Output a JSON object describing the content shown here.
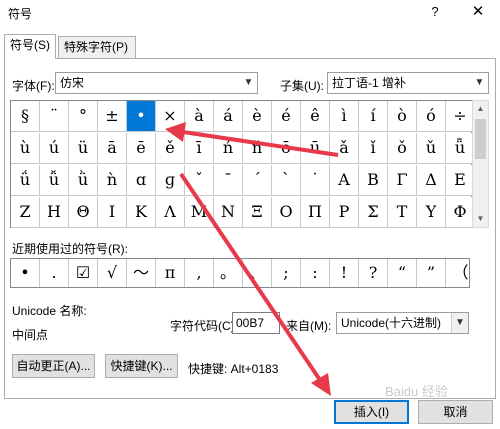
{
  "dialog": {
    "title": "符号",
    "help": "?",
    "close": "✕"
  },
  "tabs": [
    {
      "label": "符号(S)"
    },
    {
      "label": "特殊字符(P)"
    }
  ],
  "font": {
    "label": "字体(F):",
    "value": "仿宋"
  },
  "subset": {
    "label": "子集(U):",
    "value": "拉丁语-1 增补"
  },
  "symbol_grid": {
    "rows": [
      [
        "§",
        "¨",
        "°",
        "±",
        "•",
        "×",
        "à",
        "á",
        "è",
        "é",
        "ê",
        "ì",
        "í",
        "ò",
        "ó",
        "÷"
      ],
      [
        "ù",
        "ú",
        "ü",
        "ā",
        "ē",
        "ě",
        "ī",
        "ń",
        "ň",
        "ō",
        "ū",
        "ǎ",
        "ǐ",
        "ǒ",
        "ǔ",
        "ǖ"
      ],
      [
        "ǘ",
        "ǚ",
        "ǜ",
        "ǹ",
        "ɑ",
        "ɡ",
        "ˇ",
        "ˉ",
        "ˊ",
        "ˋ",
        "˙",
        "Α",
        "Β",
        "Γ",
        "Δ",
        "Ε"
      ],
      [
        "Ζ",
        "Η",
        "Θ",
        "Ι",
        "Κ",
        "Λ",
        "Μ",
        "Ν",
        "Ξ",
        "Ο",
        "Π",
        "Ρ",
        "Σ",
        "Τ",
        "Υ",
        "Φ"
      ]
    ]
  },
  "recent": {
    "label": "近期使用过的符号(R):",
    "symbols": [
      "•",
      ".",
      "☑",
      "√",
      "〜",
      "π",
      ",",
      "。",
      "、",
      ";",
      ":",
      "!",
      "?",
      "“",
      "”",
      "（"
    ]
  },
  "unicode_name": {
    "label": "Unicode 名称:",
    "value": "中间点"
  },
  "char_code": {
    "label": "字符代码(C):",
    "value": "00B7"
  },
  "from": {
    "label": "来自(M):",
    "value": "Unicode(十六进制)"
  },
  "buttons": {
    "autocorrect": "自动更正(A)...",
    "shortcut_key": "快捷键(K)...",
    "shortcut_text": "快捷键: Alt+0183",
    "insert": "插入(I)",
    "cancel": "取消"
  },
  "watermark": "Baidu 经验",
  "colors": {
    "selection": "#0078d7",
    "annotation_arrow": "#e8394a"
  }
}
